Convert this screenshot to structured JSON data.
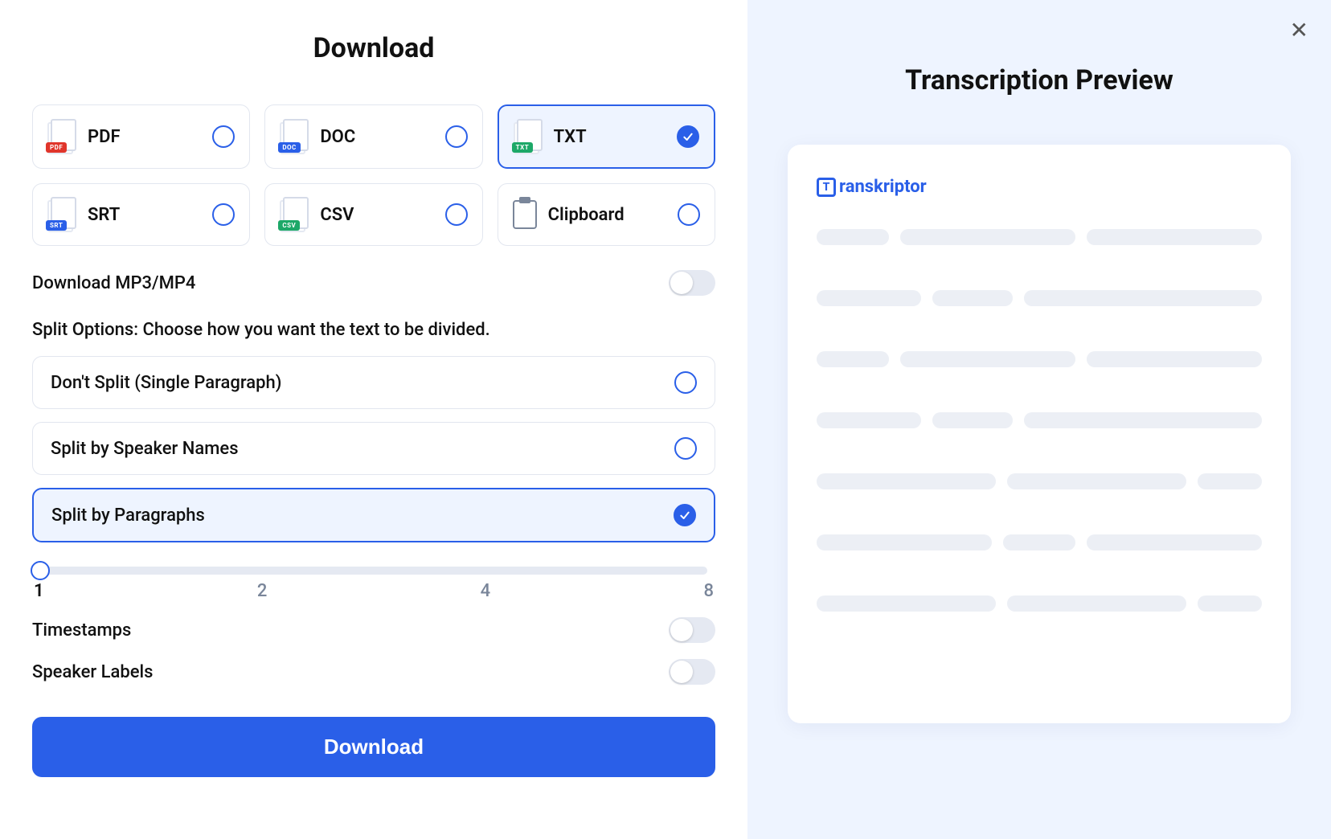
{
  "left": {
    "title": "Download",
    "formats": [
      {
        "id": "pdf",
        "label": "PDF",
        "tagClass": "tag-pdf",
        "selected": false
      },
      {
        "id": "doc",
        "label": "DOC",
        "tagClass": "tag-doc",
        "selected": false
      },
      {
        "id": "txt",
        "label": "TXT",
        "tagClass": "tag-txt",
        "selected": true
      },
      {
        "id": "srt",
        "label": "SRT",
        "tagClass": "tag-srt",
        "selected": false
      },
      {
        "id": "csv",
        "label": "CSV",
        "tagClass": "tag-csv",
        "selected": false
      },
      {
        "id": "clipboard",
        "label": "Clipboard",
        "isClipboard": true,
        "selected": false
      }
    ],
    "mp3mp4": {
      "label": "Download MP3/MP4",
      "on": false
    },
    "splitHeading": "Split Options: Choose how you want the text to be divided.",
    "splitOptions": [
      {
        "label": "Don't Split (Single Paragraph)",
        "selected": false
      },
      {
        "label": "Split by Speaker Names",
        "selected": false
      },
      {
        "label": "Split by Paragraphs",
        "selected": true
      }
    ],
    "slider": {
      "value": 1,
      "ticks": [
        "1",
        "2",
        "4",
        "8"
      ]
    },
    "timestamps": {
      "label": "Timestamps",
      "on": false
    },
    "speakerLabels": {
      "label": "Speaker Labels",
      "on": false
    },
    "downloadButton": "Download"
  },
  "right": {
    "title": "Transcription Preview",
    "brand": "ranskriptor"
  }
}
